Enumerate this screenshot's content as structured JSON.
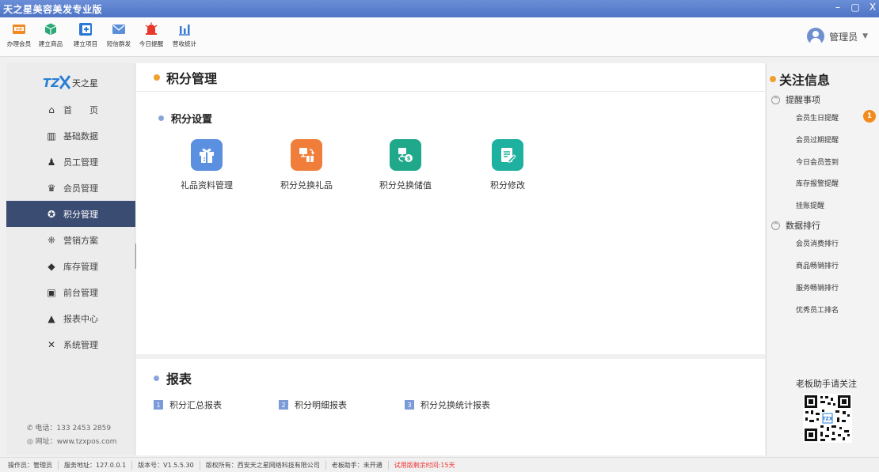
{
  "window": {
    "title": "天之星美容美发专业版",
    "controls": [
      "–",
      "▢",
      "X"
    ]
  },
  "toolbar": {
    "items": [
      {
        "label": "办理会员",
        "icon": "vip-card-icon",
        "color": "#f08a24"
      },
      {
        "label": "建立商品",
        "icon": "product-box-icon",
        "color": "#2aa876"
      },
      {
        "label": "建立项目",
        "icon": "add-project-icon",
        "color": "#2b78d6"
      },
      {
        "label": "短信群发",
        "icon": "envelope-icon",
        "color": "#5b8fd9"
      },
      {
        "label": "今日提醒",
        "icon": "alarm-bell-icon",
        "color": "#e8382c"
      },
      {
        "label": "营收统计",
        "icon": "bar-stats-icon",
        "color": "#3a7bd5"
      }
    ],
    "user": "管理员"
  },
  "sidebar": {
    "logo_text": "TZX天之星",
    "items": [
      {
        "label": "首　　页",
        "icon": "home-icon"
      },
      {
        "label": "基础数据",
        "icon": "bar-chart-icon"
      },
      {
        "label": "员工管理",
        "icon": "staff-icon"
      },
      {
        "label": "会员管理",
        "icon": "crown-icon"
      },
      {
        "label": "积分管理",
        "icon": "points-icon",
        "active": true
      },
      {
        "label": "营销方案",
        "icon": "marketing-icon"
      },
      {
        "label": "库存管理",
        "icon": "inventory-cube-icon"
      },
      {
        "label": "前台管理",
        "icon": "monitor-icon"
      },
      {
        "label": "报表中心",
        "icon": "report-icon"
      },
      {
        "label": "系统管理",
        "icon": "tools-icon"
      }
    ],
    "phone": "电话：133 2453 2859",
    "website": "网址：www.tzxpos.com"
  },
  "main": {
    "page_title": "积分管理",
    "section_title": "积分设置",
    "functions": [
      {
        "label": "礼品资料管理",
        "icon": "gift-icon",
        "color": "#5b8fe0"
      },
      {
        "label": "积分兑换礼品",
        "icon": "exchange-gift-icon",
        "color": "#f07e3a"
      },
      {
        "label": "积分兑换储值",
        "icon": "exchange-value-icon",
        "color": "#1fa88a"
      },
      {
        "label": "积分修改",
        "icon": "edit-doc-icon",
        "color": "#1fb1a0"
      }
    ],
    "report_title": "报表",
    "reports": [
      {
        "num": "1",
        "label": "积分汇总报表"
      },
      {
        "num": "2",
        "label": "积分明细报表"
      },
      {
        "num": "3",
        "label": "积分兑换统计报表"
      }
    ]
  },
  "rightpanel": {
    "title": "关注信息",
    "group1": {
      "label": "提醒事项",
      "items": [
        "会员生日提醒",
        "会员过期提醒",
        "今日会员签到",
        "库存报警提醒",
        "挂账提醒"
      ],
      "badge": "1"
    },
    "group2": {
      "label": "数据排行",
      "items": [
        "会员消费排行",
        "商品畅销排行",
        "服务畅销排行",
        "优秀员工排名"
      ]
    },
    "qr_label": "老板助手请关注"
  },
  "statusbar": {
    "operator": "操作员：管理员",
    "server": "服务地址：127.0.0.1",
    "version": "版本号：V1.5.5.30",
    "copyright": "版权所有：西安天之星网络科技有限公司",
    "assistant": "老板助手：未开通",
    "trial": "试用版剩余时间:15天"
  }
}
